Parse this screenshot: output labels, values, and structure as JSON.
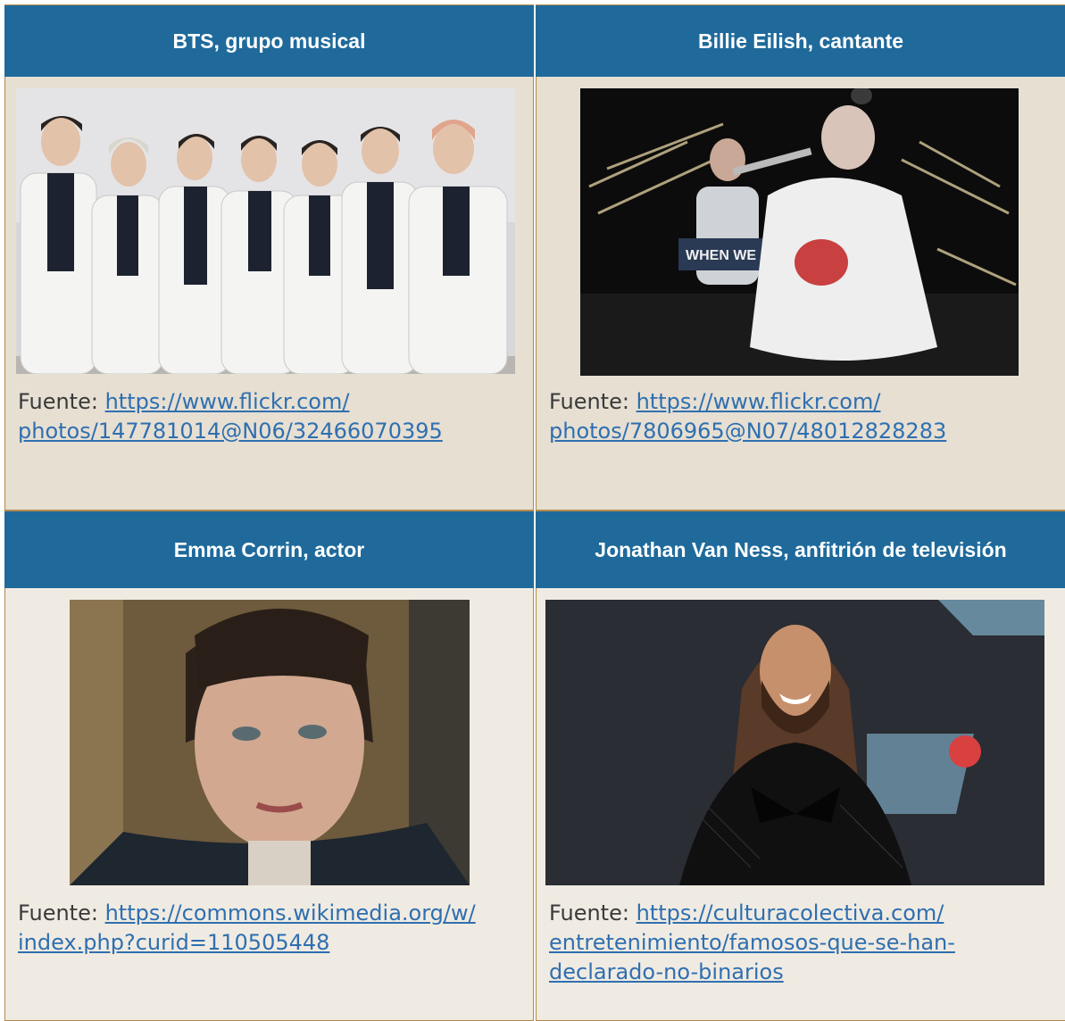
{
  "cards": [
    {
      "title": "BTS, grupo musical",
      "source_label": "Fuente:",
      "link_line1": "https://www.flickr.com/",
      "link_line2": "photos/147781014@N06/32466070395",
      "link_line3": ""
    },
    {
      "title": "Billie Eilish, cantante",
      "source_label": "Fuente:",
      "link_line1": "https://www.flickr.com/",
      "link_line2": "photos/7806965@N07/48012828283",
      "link_line3": "",
      "photo_text": "WHEN WE"
    },
    {
      "title": "Emma Corrin, actor",
      "source_label": "Fuente:",
      "link_line1": "https://commons.wikimedia.org/w/",
      "link_line2": "index.php?curid=110505448",
      "link_line3": ""
    },
    {
      "title": "Jonathan Van Ness, anfitrión de televisión",
      "source_label": "Fuente:",
      "link_line1": "https://culturacolectiva.com/",
      "link_line2": "entretenimiento/famosos-que-se-han-",
      "link_line3": "declarado-no-binarios"
    }
  ],
  "colors": {
    "header_bg": "#1f6a9b",
    "header_text": "#ffffff",
    "cell_bg": "#e6dfd2",
    "cell_bg_alt": "#f0ebe2",
    "border": "#b58a4a",
    "link": "#2f6fb0"
  }
}
